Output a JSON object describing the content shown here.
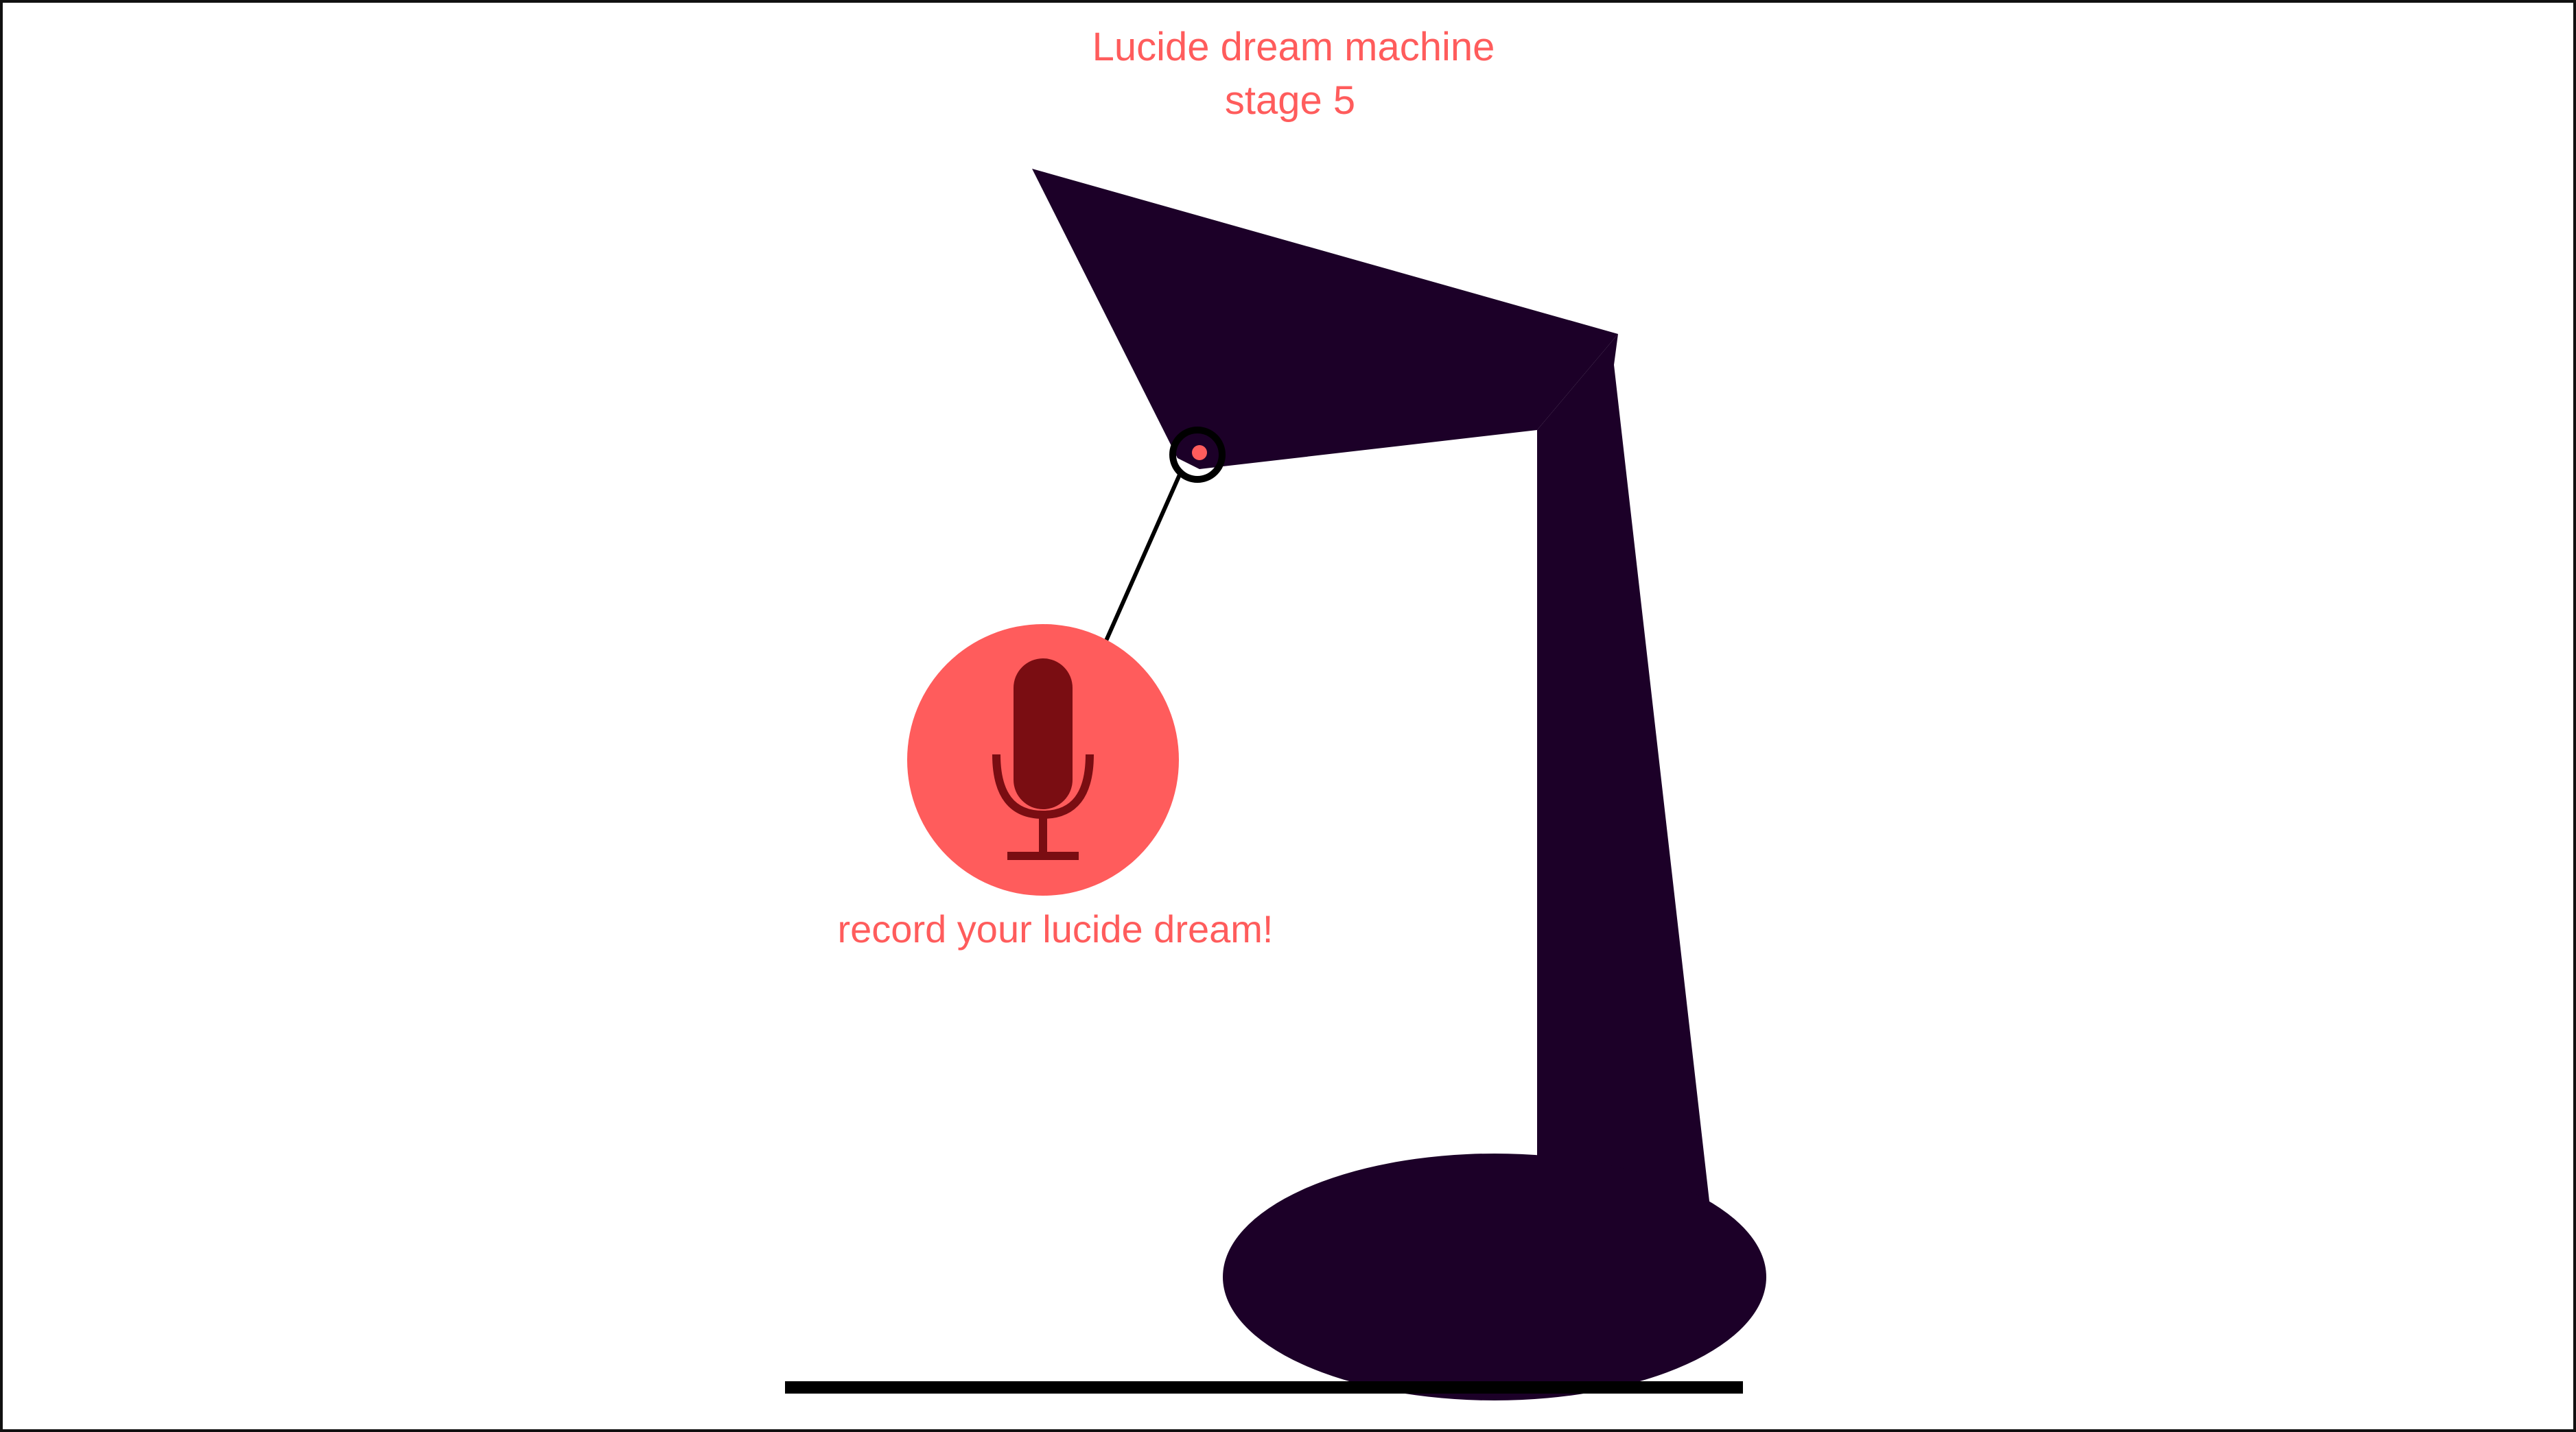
{
  "app": {
    "title_line1": "Lucide dream machine",
    "title_line2": "stage 5",
    "record_prompt": "record your lucide dream!"
  },
  "colors": {
    "page_background": "#ffffff",
    "accent": "#ff5c5c",
    "lamp": "#1c0028",
    "mic_capsule": "#7a0d12",
    "mic_stand": "#7a0d12",
    "cord": "#000000",
    "floor": "#000000"
  },
  "icons": {
    "record_button": "microphone-icon",
    "lamp_hinge": "hinge-pivot-icon"
  }
}
